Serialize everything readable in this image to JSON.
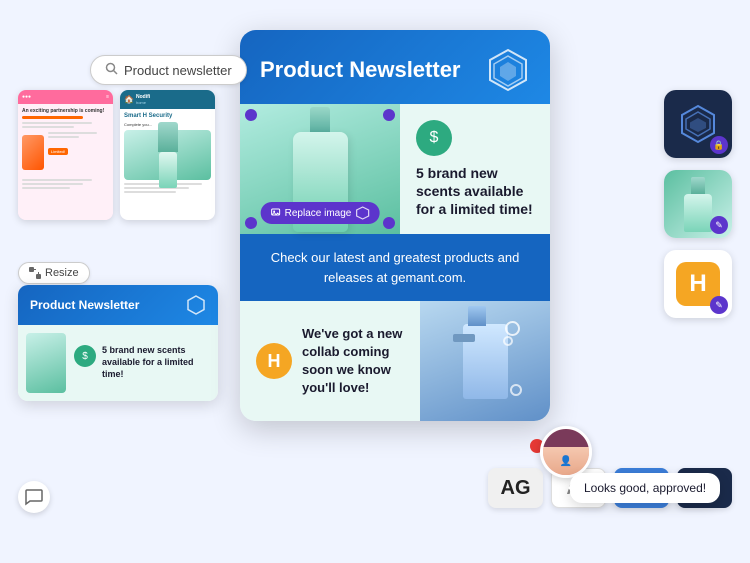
{
  "search": {
    "placeholder": "Product newsletter",
    "value": "Product newsletter"
  },
  "resize_btn": "Resize",
  "main_card": {
    "title": "Product Newsletter",
    "section1_text": "5 brand new scents available for a limited time!",
    "section2_text": "Check our latest and greatest products and releases at gemant.com.",
    "section3_text": "We've got a new collab coming soon we know you'll love!",
    "replace_image": "Replace image"
  },
  "mini_card": {
    "title": "Product Newsletter",
    "section_text": "5 brand new scents available for a limited time!"
  },
  "approval": {
    "message": "Looks good, approved!"
  },
  "right_icons": {
    "top_label": "hex-icon",
    "middle_label": "bottle-icon",
    "bottom_label": "h-badge-icon"
  },
  "bottom_icons": {
    "ag_bold": "AG",
    "ag_light": "Ag"
  }
}
